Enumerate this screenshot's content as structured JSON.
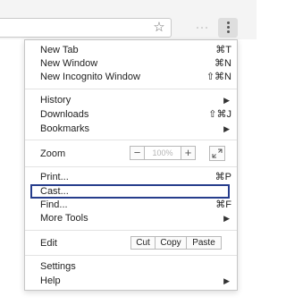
{
  "toolbar": {
    "star_icon": "star-icon",
    "menu_icon": "three-dot-menu-icon"
  },
  "menu": {
    "group1": [
      {
        "label": "New Tab",
        "shortcut": "⌘T"
      },
      {
        "label": "New Window",
        "shortcut": "⌘N"
      },
      {
        "label": "New Incognito Window",
        "shortcut": "⇧⌘N"
      }
    ],
    "group2": [
      {
        "label": "History",
        "submenu": true
      },
      {
        "label": "Downloads",
        "shortcut": "⇧⌘J"
      },
      {
        "label": "Bookmarks",
        "submenu": true
      }
    ],
    "zoom": {
      "label": "Zoom",
      "minus": "−",
      "value": "100%",
      "plus": "+"
    },
    "group4": [
      {
        "label": "Print...",
        "shortcut": "⌘P"
      },
      {
        "label": "Cast..."
      },
      {
        "label": "Find...",
        "shortcut": "⌘F"
      },
      {
        "label": "More Tools",
        "submenu": true
      }
    ],
    "edit": {
      "label": "Edit",
      "cut": "Cut",
      "copy": "Copy",
      "paste": "Paste"
    },
    "group6": [
      {
        "label": "Settings"
      },
      {
        "label": "Help",
        "submenu": true
      }
    ],
    "submenu_arrow": "▶",
    "highlight_color": "#263d8c"
  }
}
